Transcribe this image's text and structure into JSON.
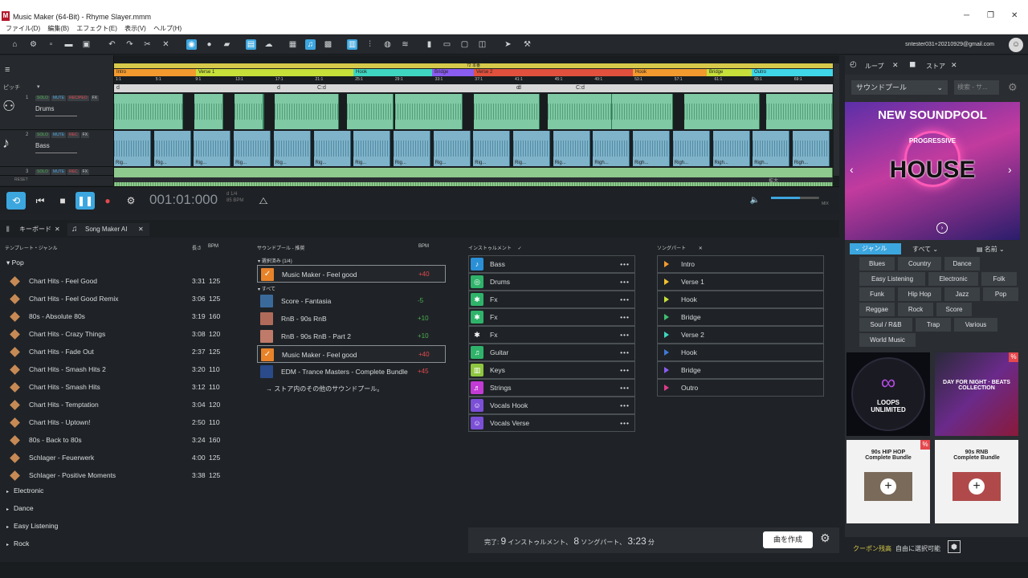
{
  "window": {
    "title": "Music Maker (64-Bit) - Rhyme Slayer.mmm",
    "logo": "M",
    "min": "─",
    "max": "❐",
    "close": "✕"
  },
  "menu": [
    "ファイル(D)",
    "編集(B)",
    "エフェクト(E)",
    "表示(V)",
    "ヘルプ(H)"
  ],
  "toolbar": {
    "user": "sntester031+20210929@gmail.com"
  },
  "tracks": [
    {
      "num": "1",
      "name": "Drums",
      "solo": "SOLO",
      "mute": "MUTE",
      "rec": "REC/PEO",
      "fx": "FX"
    },
    {
      "num": "2",
      "name": "Bass",
      "solo": "SOLO",
      "mute": "MUTE",
      "rec": "REC",
      "fx": "FX"
    },
    {
      "num": "3",
      "name": "",
      "solo": "SOLO",
      "mute": "MUTE",
      "rec": "REC",
      "fx": "FX"
    }
  ],
  "pitch_label": "ピッチ",
  "arrange": {
    "marker": "72 本番",
    "parts": [
      {
        "label": "Intro",
        "color": "#f39a2e"
      },
      {
        "label": "Verse 1",
        "color": "#c7e03a"
      },
      {
        "label": "Hook",
        "color": "#3fd6c0"
      },
      {
        "label": "Bridge",
        "color": "#8a5cf0"
      },
      {
        "label": "Verse 2",
        "color": "#e0503c"
      },
      {
        "label": "Hook",
        "color": "#f39a2e"
      },
      {
        "label": "Bridge",
        "color": "#c7e03a"
      },
      {
        "label": "Outro",
        "color": "#3fd6e8"
      }
    ],
    "bars": [
      "1:1",
      "5:1",
      "9:1",
      "13:1",
      "17:1",
      "21:1",
      "25:1",
      "29:1",
      "33:1",
      "37:1",
      "41:1",
      "45:1",
      "49:1",
      "53:1",
      "57:1",
      "61:1",
      "65:1",
      "69:1"
    ],
    "chords": [
      "d",
      "d",
      "C:d",
      "d",
      "d",
      "C:d"
    ],
    "clip_label_bass": "Rig...",
    "clip_label_bass2": "Righ...",
    "zoom_label": "拡大",
    "reset_label": "RESET"
  },
  "transport": {
    "timecode": "001:01:000",
    "meter": "d  1/4",
    "bpm": "85 BPM",
    "mix": "MIX"
  },
  "tabs": [
    {
      "label": "キーボード"
    },
    {
      "label": "Song Maker AI"
    }
  ],
  "templates": {
    "header": "テンプレート・ジャンル",
    "len_header": "長さ",
    "bpm_header": "BPM",
    "open_genre": "Pop",
    "items": [
      {
        "name": "Chart Hits - Feel Good",
        "len": "3:31",
        "bpm": "125"
      },
      {
        "name": "Chart Hits - Feel Good Remix",
        "len": "3:06",
        "bpm": "125"
      },
      {
        "name": "80s - Absolute 80s",
        "len": "3:19",
        "bpm": "160"
      },
      {
        "name": "Chart Hits - Crazy Things",
        "len": "3:08",
        "bpm": "120"
      },
      {
        "name": "Chart Hits - Fade Out",
        "len": "2:37",
        "bpm": "125"
      },
      {
        "name": "Chart Hits - Smash Hits 2",
        "len": "3:20",
        "bpm": "110"
      },
      {
        "name": "Chart Hits - Smash Hits",
        "len": "3:12",
        "bpm": "110"
      },
      {
        "name": "Chart Hits - Temptation",
        "len": "3:04",
        "bpm": "120"
      },
      {
        "name": "Chart Hits - Uptown!",
        "len": "2:50",
        "bpm": "110"
      },
      {
        "name": "80s - Back to 80s",
        "len": "3:24",
        "bpm": "160"
      },
      {
        "name": "Schlager - Feuerwerk",
        "len": "4:00",
        "bpm": "125"
      },
      {
        "name": "Schlager - Positive Moments",
        "len": "3:38",
        "bpm": "125"
      }
    ],
    "collapsed": [
      "Electronic",
      "Dance",
      "Easy Listening",
      "Rock"
    ]
  },
  "soundpools": {
    "header": "サウンドプール - 推奨",
    "bpm_header": "BPM",
    "selected_header": "選択済み (1/4)",
    "all_header": "すべて",
    "selected": {
      "name": "Music Maker - Feel good",
      "bpm": "+40"
    },
    "items": [
      {
        "name": "Score - Fantasia",
        "bpm": "-5",
        "color": "#3a6a9a"
      },
      {
        "name": "RnB - 90s RnB",
        "bpm": "+10",
        "color": "#b06a5a"
      },
      {
        "name": "RnB - 90s RnB - Part 2",
        "bpm": "+10",
        "color": "#c07a6a"
      },
      {
        "name": "Music Maker - Feel good",
        "bpm": "+40",
        "color": "#e8832a"
      },
      {
        "name": "EDM - Trance Masters - Complete Bundle",
        "bpm": "+45",
        "color": "#2a4a8a"
      }
    ],
    "more": "→ ストア内のその他のサウンドプール。"
  },
  "instruments": {
    "header": "インストゥルメント",
    "items": [
      {
        "name": "Bass",
        "color": "#2a8fd6",
        "icon": "♪"
      },
      {
        "name": "Drums",
        "color": "#2fb36a",
        "icon": "◎"
      },
      {
        "name": "Fx",
        "color": "#2fb36a",
        "icon": "✱"
      },
      {
        "name": "Fx",
        "color": "#2fb36a",
        "icon": "✱"
      },
      {
        "name": "Fx",
        "color": "transparent",
        "icon": "✱"
      },
      {
        "name": "Guitar",
        "color": "#2fb36a",
        "icon": "♫"
      },
      {
        "name": "Keys",
        "color": "#8ec63f",
        "icon": "▥"
      },
      {
        "name": "Strings",
        "color": "#c23bd4",
        "icon": "♬"
      },
      {
        "name": "Vocals Hook",
        "color": "#7b4fd6",
        "icon": "☺"
      },
      {
        "name": "Vocals Verse",
        "color": "#7b4fd6",
        "icon": "☺"
      }
    ]
  },
  "songparts": {
    "header": "ソングパート",
    "items": [
      {
        "name": "Intro",
        "color": "#f39a2e"
      },
      {
        "name": "Verse 1",
        "color": "#f3c02e"
      },
      {
        "name": "Hook",
        "color": "#c7e03a"
      },
      {
        "name": "Bridge",
        "color": "#3fc070"
      },
      {
        "name": "Verse 2",
        "color": "#3fd6c0"
      },
      {
        "name": "Hook",
        "color": "#3f7ad6"
      },
      {
        "name": "Bridge",
        "color": "#8a5cf0"
      },
      {
        "name": "Outro",
        "color": "#e03c8a"
      }
    ]
  },
  "status": {
    "prefix": "完了:",
    "ins_count": "9",
    "ins_label": "インストゥルメント、",
    "part_count": "8",
    "part_label": "ソングパート、",
    "duration": "3:23",
    "dur_unit": "分",
    "create": "曲を作成"
  },
  "store": {
    "tab_loops": "ループ",
    "tab_store": "ストア",
    "dropdown": "サウンドプール",
    "search_placeholder": "検索 - サ...",
    "banner_title": "NEW SOUNDPOOL",
    "banner_sub": "PROGRESSIVE",
    "banner_main": "HOUSE",
    "filter_genre": "ジャンル",
    "filter_all": "すべて",
    "filter_sort": "名前",
    "genres": [
      "Blues",
      "Country",
      "Dance",
      "Easy Listening",
      "Electronic",
      "Folk",
      "Funk",
      "Hip Hop",
      "Jazz",
      "Pop",
      "Reggae",
      "Rock",
      "Score",
      "Soul / R&B",
      "Trap",
      "Various",
      "World Music"
    ],
    "tiles": [
      {
        "text": "LOOPS\nUNLIMITED"
      },
      {
        "text": "DAY FOR NIGHT · BEATS COLLECTION"
      },
      {
        "text": "90s HIP HOP\nComplete Bundle"
      },
      {
        "text": "90s RNB\nComplete Bundle"
      }
    ],
    "badge": "%",
    "footer_coupon": "クーポン残高",
    "footer_free": "自由に選択可能"
  }
}
